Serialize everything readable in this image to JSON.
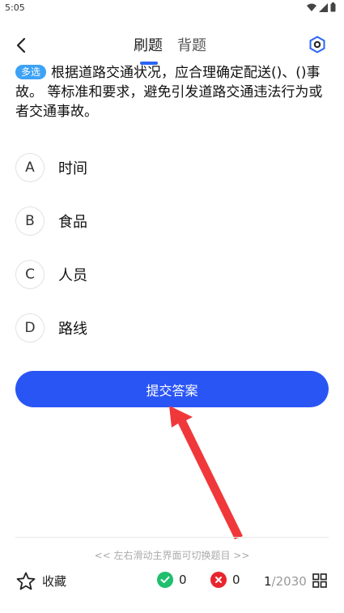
{
  "status_bar": {
    "time": "5:05"
  },
  "header": {
    "tabs": [
      {
        "label": "刷题",
        "active": true
      },
      {
        "label": "背题",
        "active": false
      }
    ]
  },
  "question": {
    "type_badge": "多选",
    "text": "根据道路交通状况，应合理确定配送()、()事故。 等标准和要求，避免引发道路交通违法行为或者交通事故。"
  },
  "options": [
    {
      "key": "A",
      "text": "时间"
    },
    {
      "key": "B",
      "text": "食品"
    },
    {
      "key": "C",
      "text": "人员"
    },
    {
      "key": "D",
      "text": "路线"
    }
  ],
  "submit_label": "提交答案",
  "swipe_hint": "<< 左右滑动主界面可切换题目 >>",
  "bottom_bar": {
    "favorite_label": "收藏",
    "correct_count": "0",
    "wrong_count": "0",
    "current": "1",
    "total": "/2030"
  },
  "colors": {
    "accent": "#2a55f5",
    "badge": "#3da2f5",
    "correct": "#1fbf6d",
    "wrong": "#e8262e",
    "annotation_arrow": "#f0383a"
  }
}
